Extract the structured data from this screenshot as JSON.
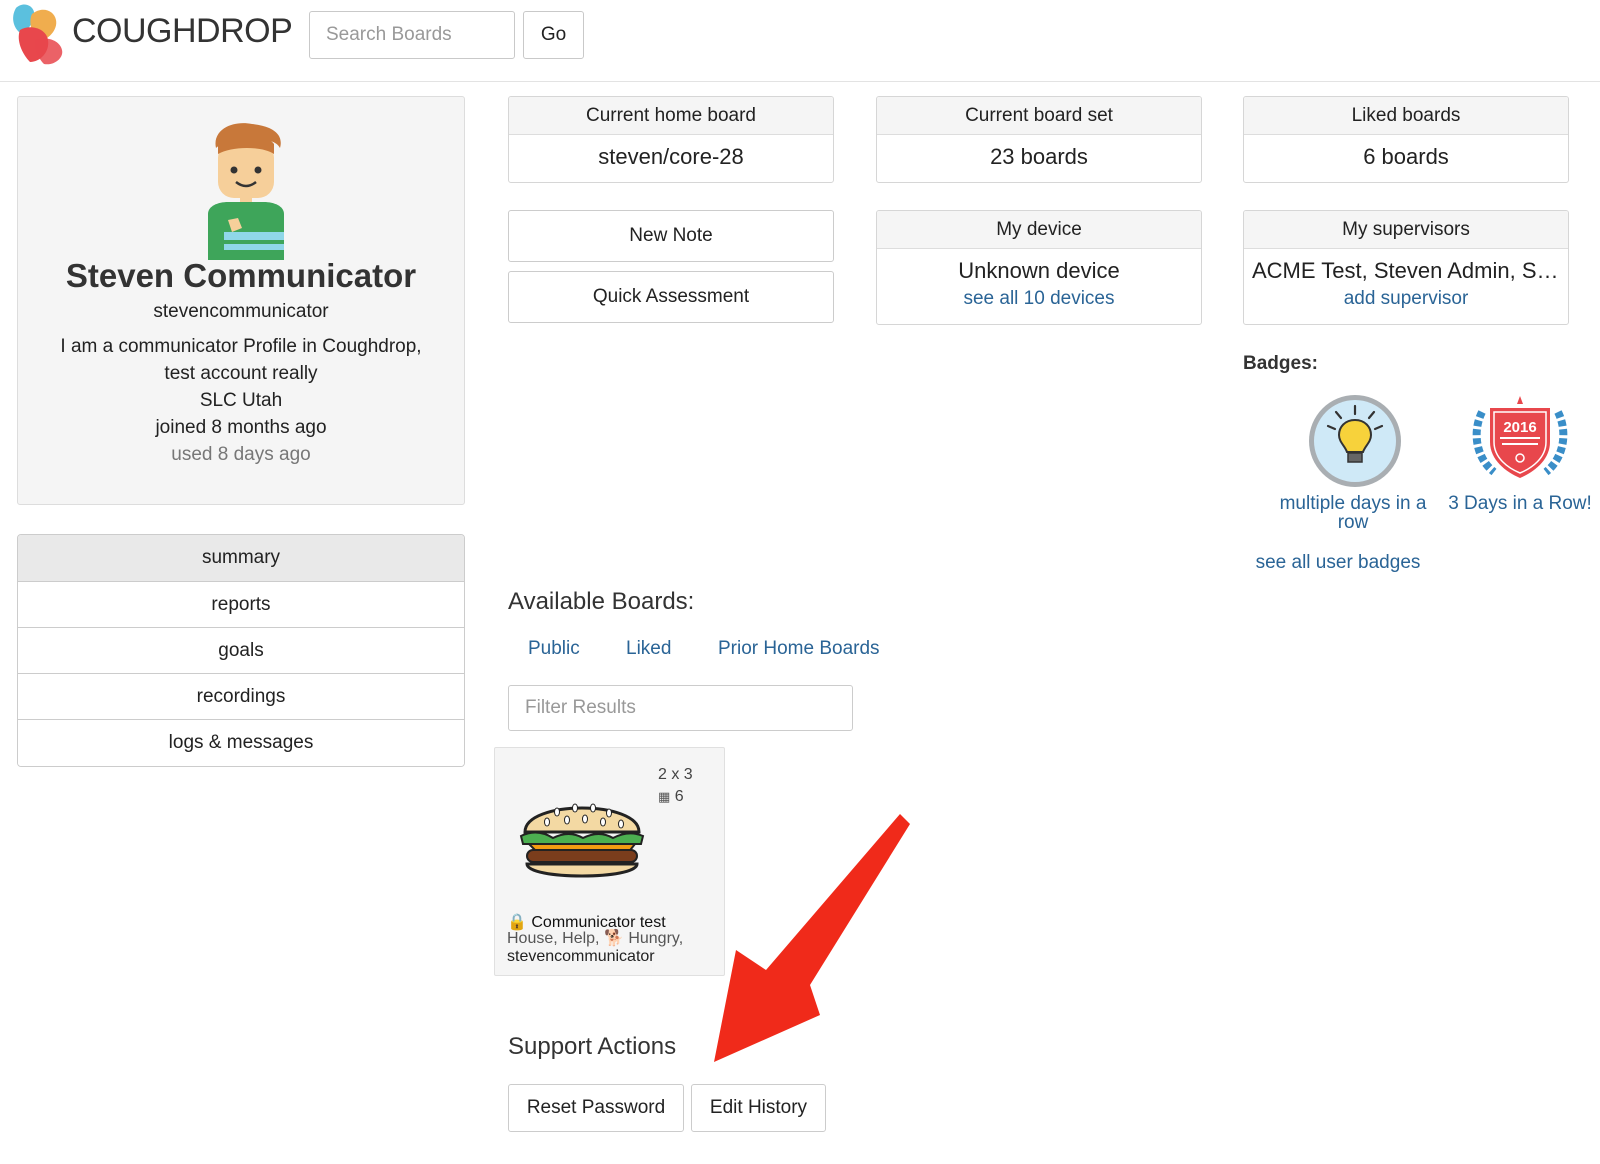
{
  "header": {
    "brand": "COUGHDROP",
    "search_placeholder": "Search Boards",
    "go_label": "Go"
  },
  "profile": {
    "name": "Steven Communicator",
    "username": "stevencommunicator",
    "bio_lines": [
      "I am a communicator Profile in Coughdrop,",
      "test account really"
    ],
    "location": "SLC Utah",
    "joined": "joined 8 months ago",
    "used": "used 8 days ago"
  },
  "nav": {
    "items": [
      {
        "label": "summary",
        "active": true
      },
      {
        "label": "reports"
      },
      {
        "label": "goals"
      },
      {
        "label": "recordings"
      },
      {
        "label": "logs & messages"
      }
    ]
  },
  "panels": {
    "home_board": {
      "title": "Current home board",
      "value": "steven/core-28"
    },
    "board_set": {
      "title": "Current board set",
      "value": "23 boards"
    },
    "liked": {
      "title": "Liked boards",
      "value": "6 boards"
    },
    "device": {
      "title": "My device",
      "value": "Unknown device",
      "link": "see all 10 devices"
    },
    "supervisors": {
      "title": "My supervisors",
      "value": "ACME Test, Steven Admin, Steven",
      "link": "add supervisor"
    }
  },
  "actions": {
    "new_note": "New Note",
    "quick_assessment": "Quick Assessment"
  },
  "badges": {
    "title": "Badges:",
    "items": [
      {
        "label_line1": "multiple days in a",
        "label_line2": "row",
        "icon": "lightbulb-icon"
      },
      {
        "label": "3 Days in a Row!",
        "icon": "award-seal-icon",
        "seal_text": "2016"
      }
    ],
    "see_all": "see all user badges"
  },
  "available_boards": {
    "title": "Available Boards:",
    "tabs": [
      "Public",
      "Liked",
      "Prior Home Boards"
    ],
    "filter_placeholder": "Filter Results",
    "boards": [
      {
        "grid": "2 x 3",
        "count": "6",
        "name": "Communicator test",
        "desc_line1": "House, Help,",
        "desc_line2": "Hungry,",
        "owner": "stevencommunicator",
        "icon": "hamburger-icon"
      }
    ]
  },
  "support": {
    "title": "Support Actions",
    "reset_password": "Reset Password",
    "edit_history": "Edit History"
  },
  "colors": {
    "link": "#2a6496",
    "panel_header": "#f5f5f5",
    "arrow": "#f02a1a"
  }
}
